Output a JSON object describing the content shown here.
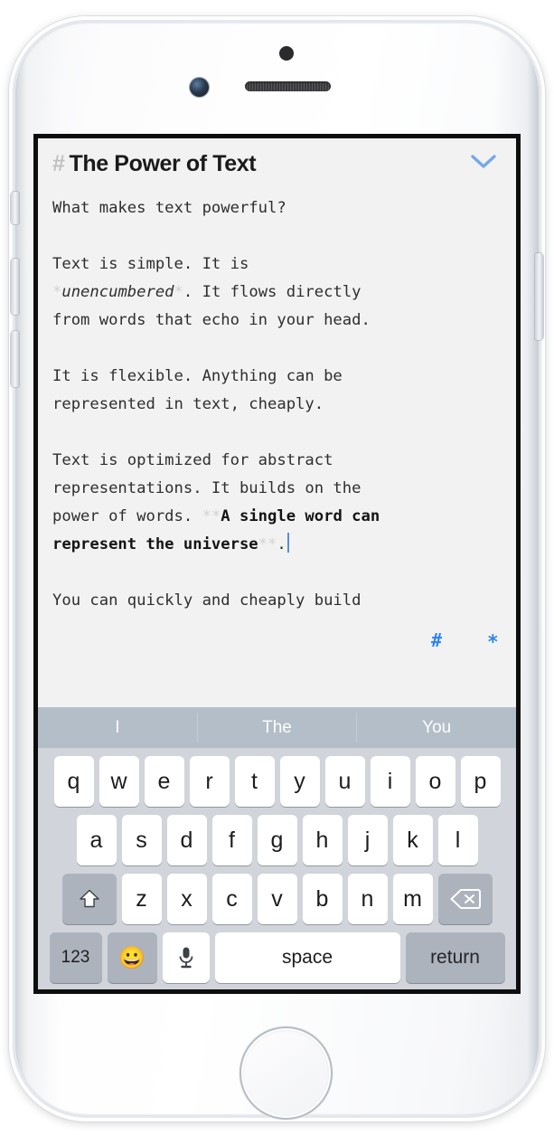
{
  "device": {
    "name": "iphone-white-silver",
    "hardware": [
      "sensor-dot",
      "front-camera",
      "earpiece-speaker",
      "home-button",
      "mute-switch",
      "volume-up",
      "volume-down",
      "power-button"
    ]
  },
  "note": {
    "hash_prefix": "#",
    "title": "The Power of Text",
    "collapse_icon": "chevron-down-icon",
    "paragraphs": [
      {
        "id": "p1",
        "runs": [
          {
            "t": "What makes text powerful?",
            "s": "plain"
          }
        ]
      },
      {
        "id": "p2",
        "runs": [
          {
            "t": "Text is simple. It is\n",
            "s": "plain"
          },
          {
            "t": "*",
            "s": "dim"
          },
          {
            "t": "unencumbered",
            "s": "em"
          },
          {
            "t": "*",
            "s": "dim"
          },
          {
            "t": ". It flows directly\nfrom words that echo in your head.",
            "s": "plain"
          }
        ]
      },
      {
        "id": "p3",
        "runs": [
          {
            "t": "It is flexible. Anything can be\nrepresented in text, cheaply.",
            "s": "plain"
          }
        ]
      },
      {
        "id": "p4",
        "runs": [
          {
            "t": "Text is optimized for abstract\nrepresentations. It builds on the\npower of words. ",
            "s": "plain"
          },
          {
            "t": "**",
            "s": "dim"
          },
          {
            "t": "A single word can\nrepresent the universe",
            "s": "strong"
          },
          {
            "t": "**",
            "s": "dim"
          },
          {
            "t": ".",
            "s": "plain"
          }
        ]
      },
      {
        "id": "p5",
        "runs": [
          {
            "t": "You can quickly and cheaply build",
            "s": "plain"
          }
        ]
      }
    ],
    "cursor": {
      "visible": true,
      "color": "#5b8dd6"
    },
    "markdown_shortcuts": [
      {
        "label": "#",
        "name": "heading-shortcut"
      },
      {
        "label": "*",
        "name": "emphasis-shortcut"
      }
    ]
  },
  "keyboard": {
    "predictive": [
      "I",
      "The",
      "You"
    ],
    "row1": [
      "q",
      "w",
      "e",
      "r",
      "t",
      "y",
      "u",
      "i",
      "o",
      "p"
    ],
    "row2": [
      "a",
      "s",
      "d",
      "f",
      "g",
      "h",
      "j",
      "k",
      "l"
    ],
    "row3": [
      "z",
      "x",
      "c",
      "v",
      "b",
      "n",
      "m"
    ],
    "shift_icon": "shift-icon",
    "backspace_icon": "backspace-icon",
    "numbers_label": "123",
    "emoji_icon": "emoji-icon",
    "mic_icon": "microphone-icon",
    "space_label": "space",
    "return_label": "return"
  },
  "colors": {
    "accent_blue": "#2f86f2",
    "cursor_blue": "#5b8dd6",
    "chevron_blue": "#74a9e8",
    "predictive_bar": "#b4bec8",
    "keyboard_bg": "#d1d4da",
    "screen_bg": "#f2f2f2",
    "dim_markdown": "#d2d2d2"
  }
}
